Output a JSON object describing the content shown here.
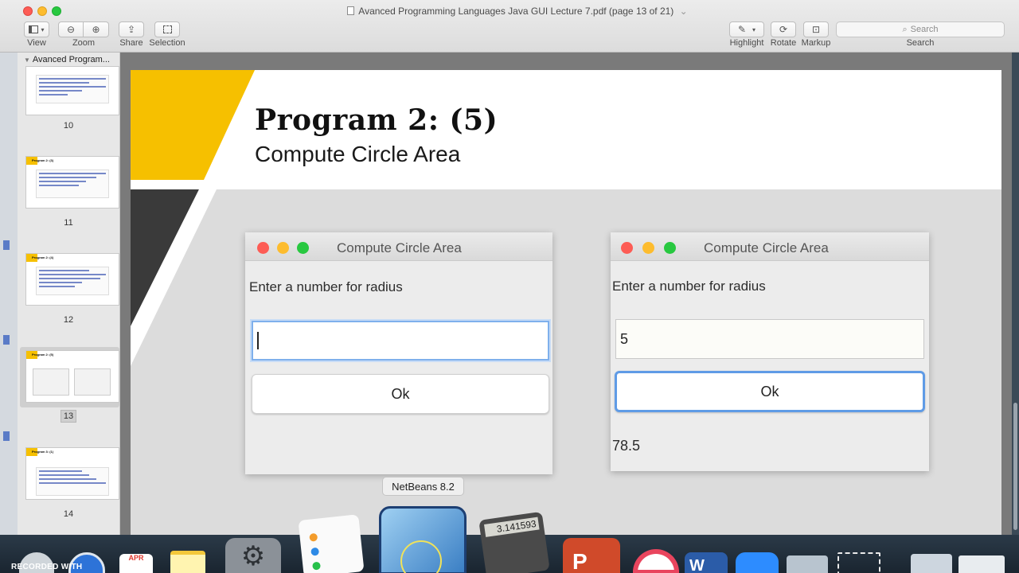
{
  "window": {
    "title": "Avanced Programming Languages Java GUI Lecture 7.pdf (page 13 of 21)",
    "title_suffix": "⌄"
  },
  "toolbar": {
    "view_label": "View",
    "zoom_label": "Zoom",
    "share_label": "Share",
    "selection_label": "Selection",
    "highlight_label": "Highlight",
    "rotate_label": "Rotate",
    "markup_label": "Markup",
    "search_label": "Search",
    "search_placeholder": "Search"
  },
  "sidebar": {
    "doc_title": "Avanced Program...",
    "pages": [
      {
        "num": "10"
      },
      {
        "num": "11",
        "thumb_title": "Program 2: (3)"
      },
      {
        "num": "12",
        "thumb_title": "Program 2: (4)"
      },
      {
        "num": "13",
        "thumb_title": "Program 2: (5)"
      },
      {
        "num": "14",
        "thumb_title": "Program 3: (1)"
      }
    ]
  },
  "slide": {
    "title": "Program 2: (5)",
    "subtitle": "Compute Circle Area",
    "windows": [
      {
        "title": "Compute Circle Area",
        "prompt": "Enter a number for radius",
        "input_value": "",
        "button_label": "Ok",
        "result": ""
      },
      {
        "title": "Compute Circle Area",
        "prompt": "Enter a number for radius",
        "input_value": "5",
        "button_label": "Ok",
        "result": "78.5"
      }
    ]
  },
  "dock": {
    "tooltip": "NetBeans 8.2",
    "recorded_label": "RECORDED WITH",
    "calendar_month": "APR",
    "calculator_display": "3.141593"
  },
  "colors": {
    "accent_yellow": "#f6c000",
    "dark_band": "#3a3a3a",
    "focus_blue": "#5f9be6"
  }
}
